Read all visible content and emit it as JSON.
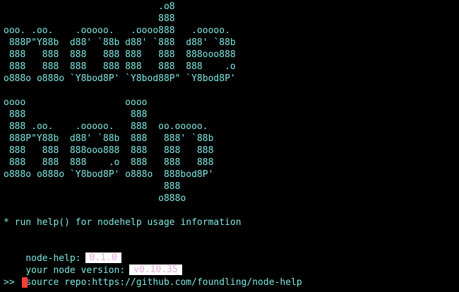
{
  "banner": {
    "nodehelp_ascii": [
      "                            .o8",
      "                            888",
      "ooo. .oo.    .ooooo.   .oooo888   .ooooo.",
      " 888P\"Y88b  d88' `88b d88' `888  d88' `88b",
      " 888   888  888   888 888   888  888ooo888",
      " 888   888  888   888 888   888  888    .o",
      "o888o o888o `Y8bod8P' `Y8bod88P\" `Y8bod8P'",
      "",
      "oooo                  oooo",
      " 888                   888",
      " 888 .oo.    .ooooo.   888  oo.ooooo.",
      " 888P\"Y88b  d88' `88b  888   888' `88b",
      " 888   888  888ooo888  888   888   888",
      " 888   888  888    .o  888   888   888",
      "o888o o888o `Y8bod8P' o888o  888bod8P'",
      "                             888",
      "                            o888o"
    ]
  },
  "help_hint": "* run help() for nodehelp usage information",
  "info": {
    "node_help_label": "node-help:",
    "node_help_version": "0.1.0",
    "node_version_label": "your node version:",
    "node_version_value": "v0.10.35",
    "source_repo_label": "source repo:",
    "source_repo_url": "https://github.com/foundling/node-help"
  },
  "prompt": {
    "symbol": ">>"
  },
  "colors": {
    "background": "#000000",
    "text": "#7fe7e3",
    "tag_background": "#ffffff",
    "tag_text": "#e7a8da",
    "cursor": "#ff3b3b"
  }
}
